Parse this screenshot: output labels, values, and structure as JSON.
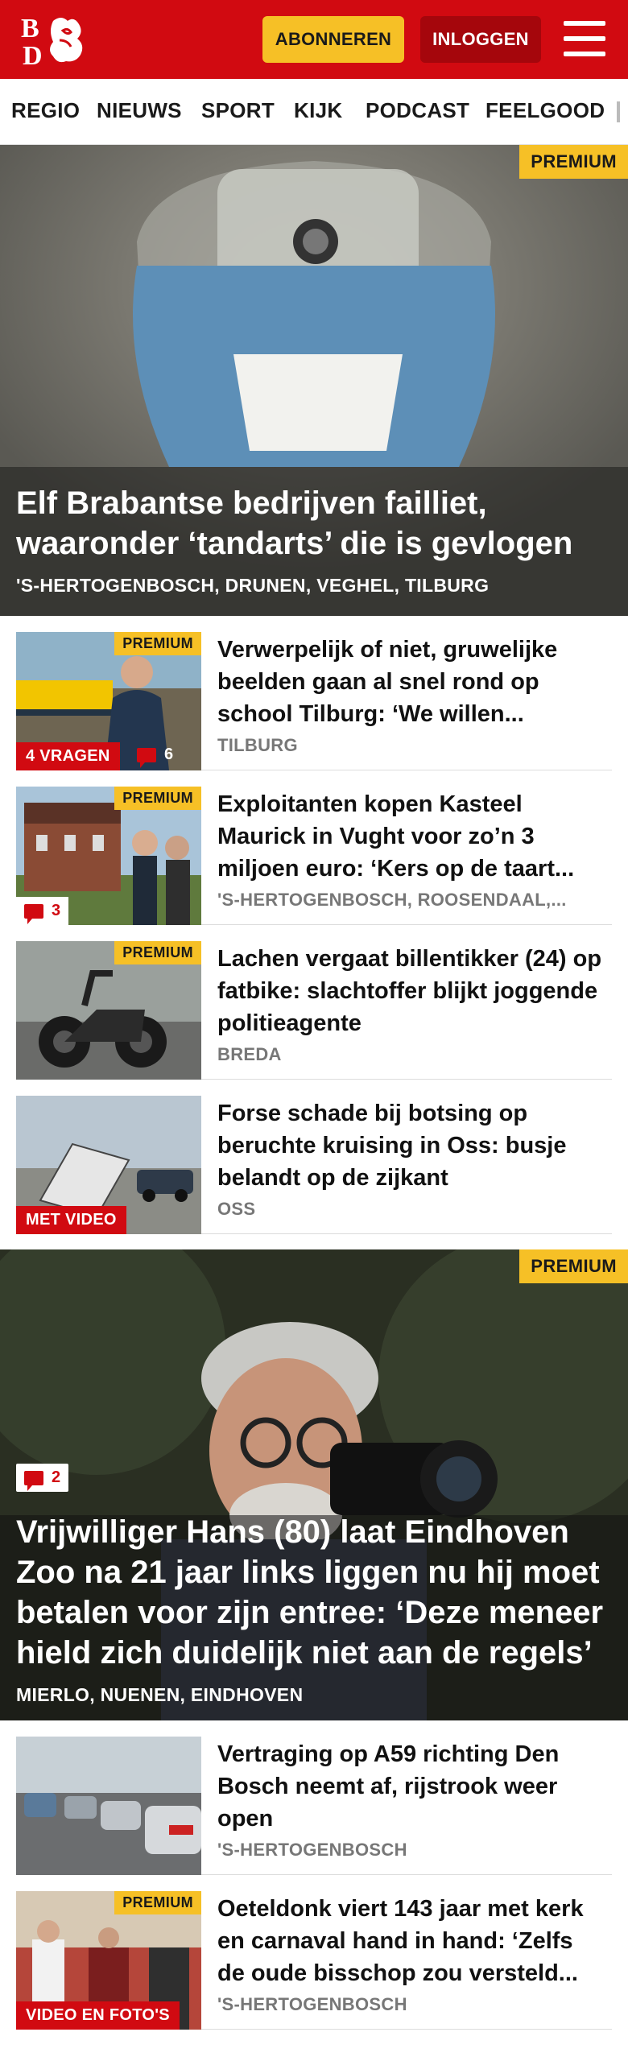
{
  "header": {
    "logo_text": "BD",
    "subscribe_label": "ABONNEREN",
    "login_label": "INLOGGEN",
    "menu_icon": "hamburger-menu-icon",
    "brand_color": "#d10a11",
    "accent_color": "#f6c026"
  },
  "nav": {
    "items": [
      "REGIO",
      "NIEUWS",
      "SPORT",
      "KIJK",
      "PODCAST",
      "FEELGOOD"
    ]
  },
  "hero1": {
    "badge": "PREMIUM",
    "title": "Elf Brabantse bedrijven failliet, waaronder ‘tandarts’ die is gevlogen",
    "location": "'S-HERTOGENBOSCH, DRUNEN, VEGHEL, TILBURG"
  },
  "articles": [
    {
      "badge": "PREMIUM",
      "tag": "4 VRAGEN",
      "comments": "6",
      "title": "Verwerpelijk of niet, gruwelijke beelden gaan al snel rond op school Tilburg: ‘We willen...",
      "location": "TILBURG"
    },
    {
      "badge": "PREMIUM",
      "comments": "3",
      "title": "Exploitanten kopen Kasteel Maurick in Vught voor zo’n 3 miljoen euro: ‘Kers op de taart...",
      "location": "'S-HERTOGENBOSCH, ROOSENDAAL,..."
    },
    {
      "badge": "PREMIUM",
      "title": "Lachen vergaat billentikker (24) op fatbike: slachtoffer blijkt joggende politieagente",
      "location": "BREDA"
    },
    {
      "tag": "MET VIDEO",
      "title": "Forse schade bij botsing op beruchte kruising in Oss: busje belandt op de zijkant",
      "location": "OSS"
    }
  ],
  "hero2": {
    "badge": "PREMIUM",
    "comments": "2",
    "title": "Vrijwilliger Hans (80) laat Eindhoven Zoo na 21 jaar links liggen nu hij moet betalen voor zijn entree: ‘Deze meneer hield zich duidelijk niet aan de regels’",
    "location": "MIERLO, NUENEN, EINDHOVEN"
  },
  "articles2": [
    {
      "title": "Vertraging op A59 richting Den Bosch neemt af, rijstrook weer open",
      "location": "'S-HERTOGENBOSCH"
    },
    {
      "badge": "PREMIUM",
      "tag": "VIDEO EN FOTO'S",
      "title": "Oeteldonk viert 143 jaar met kerk en carnaval hand in hand: ‘Zelfs de oude bisschop zou versteld...",
      "location": "'S-HERTOGENBOSCH"
    }
  ]
}
